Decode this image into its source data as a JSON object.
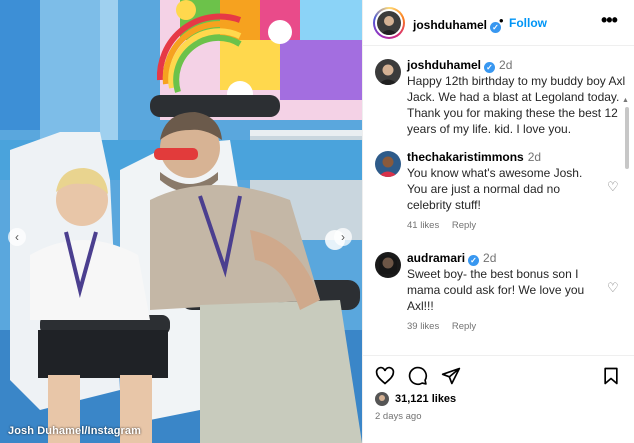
{
  "photo": {
    "credit": "Josh Duhamel/Instagram"
  },
  "header": {
    "username": "joshduhamel",
    "dot": "•",
    "follow_label": "Follow",
    "more_icon": "more-dots-icon"
  },
  "comments": [
    {
      "username": "joshduhamel",
      "time": "2d",
      "text": "Happy 12th birthday to my buddy boy Axl Jack. We had a blast at Legoland today. Thank you for making these the best 12 years of my life. kid. I love you."
    },
    {
      "username": "thechakaristimmons",
      "time": "2d",
      "text": "You know what's awesome Josh. You are just a normal dad no celebrity stuff!",
      "likes": "41 likes",
      "reply_label": "Reply"
    },
    {
      "username": "audramari",
      "time": "2d",
      "text": "Sweet boy- the best bonus son I mama could ask for! We love you Axl!!!",
      "likes": "39 likes",
      "reply_label": "Reply"
    }
  ],
  "actions": {
    "likes": "31,121 likes",
    "posted": "2 days ago"
  },
  "colors": {
    "accent": "#0095f6",
    "verified": "#3897f0",
    "meta": "#737373"
  }
}
